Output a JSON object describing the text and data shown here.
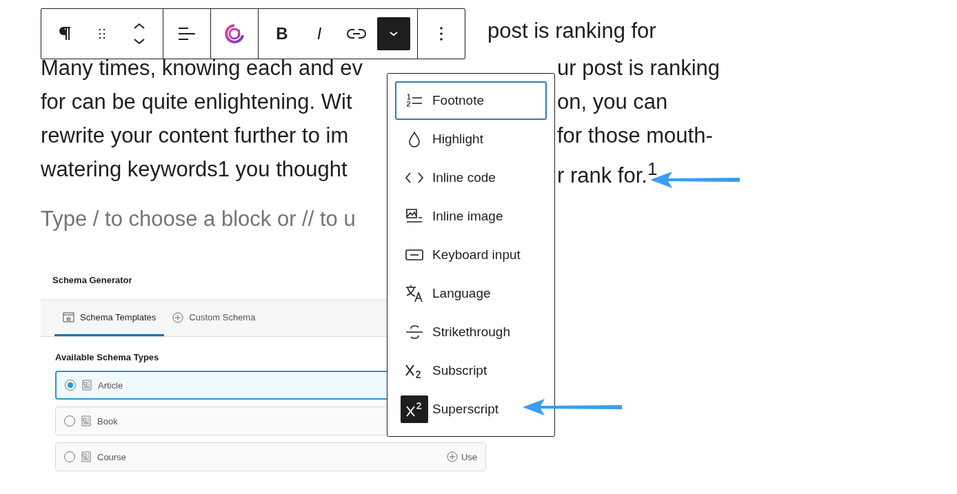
{
  "toolbar": {
    "bold": "B",
    "italic": "I",
    "more_pressed": true
  },
  "heading_visible": "post is ranking for",
  "paragraph_lines": [
    {
      "left": "Many times, knowing each and ev",
      "right": "ur post is ranking"
    },
    {
      "left": "for can be quite enlightening. Wit",
      "right": "on, you can"
    },
    {
      "left": "rewrite your content further to im",
      "right": "for those mouth-"
    },
    {
      "left": "watering keywords1 you thought",
      "right": "r rank for.$^{1}$"
    }
  ],
  "block_placeholder": "Type / to choose a block or // to u",
  "format_menu": [
    {
      "label": "Footnote",
      "selected": true,
      "active": false
    },
    {
      "label": "Highlight",
      "selected": false,
      "active": false
    },
    {
      "label": "Inline code",
      "selected": false,
      "active": false
    },
    {
      "label": "Inline image",
      "selected": false,
      "active": false
    },
    {
      "label": "Keyboard input",
      "selected": false,
      "active": false
    },
    {
      "label": "Language",
      "selected": false,
      "active": false
    },
    {
      "label": "Strikethrough",
      "selected": false,
      "active": false
    },
    {
      "label": "Subscript",
      "selected": false,
      "active": false
    },
    {
      "label": "Superscript",
      "selected": false,
      "active": true
    }
  ],
  "schema_panel": {
    "title": "Schema Generator",
    "tabs": [
      {
        "label": "Schema Templates",
        "selected": true
      },
      {
        "label": "Custom Schema",
        "selected": false
      }
    ],
    "section_title": "Available Schema Types",
    "rows": [
      {
        "label": "Article",
        "selected": true
      },
      {
        "label": "Book",
        "selected": false
      },
      {
        "label": "Course",
        "selected": false,
        "use": "Use"
      }
    ]
  }
}
